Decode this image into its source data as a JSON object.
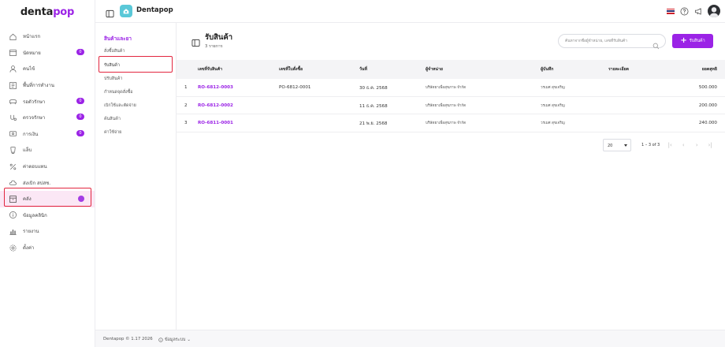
{
  "app": {
    "logo_part1": "denta",
    "logo_part2": "pop",
    "brand_name": "Dentapop"
  },
  "sidebar": {
    "items": [
      {
        "label": "หน้าแรก",
        "icon": "home-icon"
      },
      {
        "label": "นัดหมาย",
        "icon": "calendar-icon",
        "badge": "0"
      },
      {
        "label": "คนไข้",
        "icon": "user-icon"
      },
      {
        "label": "พื้นที่การทำงาน",
        "icon": "workspace-icon"
      },
      {
        "label": "รอตัวรักษา",
        "icon": "waiting-icon",
        "badge": "0"
      },
      {
        "label": "ตรวจรักษา",
        "icon": "treatment-icon",
        "badge": "0"
      },
      {
        "label": "การเงิน",
        "icon": "finance-icon",
        "badge": "0"
      },
      {
        "label": "แล็บ",
        "icon": "lab-icon"
      },
      {
        "label": "ค่าตอบแทน",
        "icon": "percent-icon"
      },
      {
        "label": "ส่งเบิก สปสช.",
        "icon": "cloud-icon"
      },
      {
        "label": "คลัง",
        "icon": "inventory-icon",
        "active": true
      },
      {
        "label": "ข้อมูลคลินิก",
        "icon": "info-icon"
      },
      {
        "label": "รายงาน",
        "icon": "report-icon"
      },
      {
        "label": "ตั้งค่า",
        "icon": "settings-icon"
      }
    ]
  },
  "subnav": {
    "title": "สินค้าและยา",
    "items": [
      "สั่งซื้อสินค้า",
      "รับสินค้า",
      "ปรับสินค้า",
      "กำหนดจุดสั่งซื้อ",
      "เบิกใช้และตัดจ่าย",
      "ค้นสินค้า",
      "ค่าใช้จ่าย"
    ],
    "active_index": 1
  },
  "page": {
    "title": "รับสินค้า",
    "subtitle": "3 รายการ",
    "search_placeholder": "ค้นหาจากชื่อผู้จำหน่าย, เลขที่รับสินค้า",
    "add_button": "รับสินค้า"
  },
  "table": {
    "headers": [
      "เลขที่รับสินค้า",
      "เลขที่ใบสั่งซื้อ",
      "วันที่",
      "ผู้จำหน่าย",
      "ผู้บันทึก",
      "รายละเอียด",
      "ยอดสุทธิ"
    ],
    "rows": [
      {
        "no": "1",
        "receipt": "RO-6812-0003",
        "po": "PO-6812-0001",
        "date": "30 ธ.ค. 2568",
        "supplier": "บริษัทยาเพื่อสุขภาพ จำกัด",
        "recorder": "วรเมศ สุขเจริญ",
        "detail": "",
        "total": "500.000"
      },
      {
        "no": "2",
        "receipt": "RO-6812-0002",
        "po": "",
        "date": "11 ธ.ค. 2568",
        "supplier": "บริษัทยาเพื่อสุขภาพ จำกัด",
        "recorder": "วรเมศ สุขเจริญ",
        "detail": "",
        "total": "200.000"
      },
      {
        "no": "3",
        "receipt": "RO-6811-0001",
        "po": "",
        "date": "21 พ.ย. 2568",
        "supplier": "บริษัทยาเพื่อสุขภาพ จำกัด",
        "recorder": "วรเมศ สุขเจริญ",
        "detail": "",
        "total": "240.000"
      }
    ]
  },
  "pagination": {
    "rows_per_page": "20",
    "range": "1 – 3 of 3"
  },
  "footer": {
    "copyright": "Dentapop © 1.17 2026",
    "system_info": "ข้อมูลระบบ"
  },
  "colors": {
    "accent": "#9b23e6",
    "active_bg": "#fbe7f5",
    "highlight_box": "#e2263f"
  }
}
